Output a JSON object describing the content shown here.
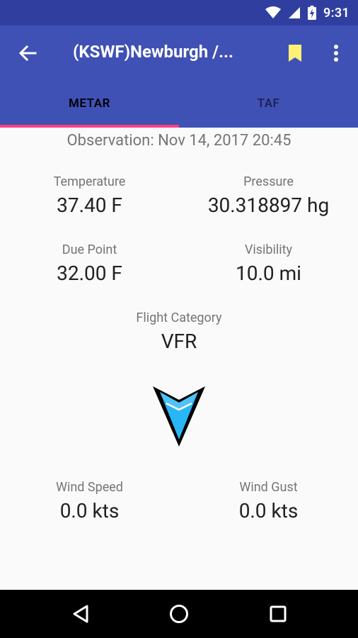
{
  "status_bar": {
    "time": "9:31",
    "icons": [
      "wifi-icon",
      "signal-icon",
      "battery-charging-icon"
    ]
  },
  "app_bar": {
    "title": "(KSWF)Newburgh /...",
    "icons": [
      "back-arrow-icon",
      "bookmark-icon",
      "overflow-menu-icon"
    ],
    "bookmark_color": "#fff176"
  },
  "tabs": [
    {
      "label": "METAR",
      "selected": true
    },
    {
      "label": "TAF",
      "selected": false
    }
  ],
  "colors": {
    "primary": "#3f51b5",
    "primary_dark": "#303f9f",
    "accent": "#ff4081",
    "arrow_fill": "#29b6f6"
  },
  "observation": {
    "text": "Observation: Nov 14, 2017 20:45"
  },
  "stats": {
    "temperature": {
      "label": "Temperature",
      "value": "37.40 F"
    },
    "pressure": {
      "label": "Pressure",
      "value": "30.318897 hg"
    },
    "dew_point": {
      "label": "Due Point",
      "value": "32.00 F"
    },
    "visibility": {
      "label": "Visibility",
      "value": "10.0 mi"
    },
    "flight_category": {
      "label": "Flight Category",
      "value": "VFR"
    },
    "wind_speed": {
      "label": "Wind Speed",
      "value": "0.0 kts"
    },
    "wind_gust": {
      "label": "Wind Gust",
      "value": "0.0 kts"
    }
  },
  "wind_direction_icon": "wind-direction-arrow-icon",
  "nav_bar": {
    "icons": [
      "back-triangle-icon",
      "home-circle-icon",
      "recents-square-icon"
    ]
  }
}
